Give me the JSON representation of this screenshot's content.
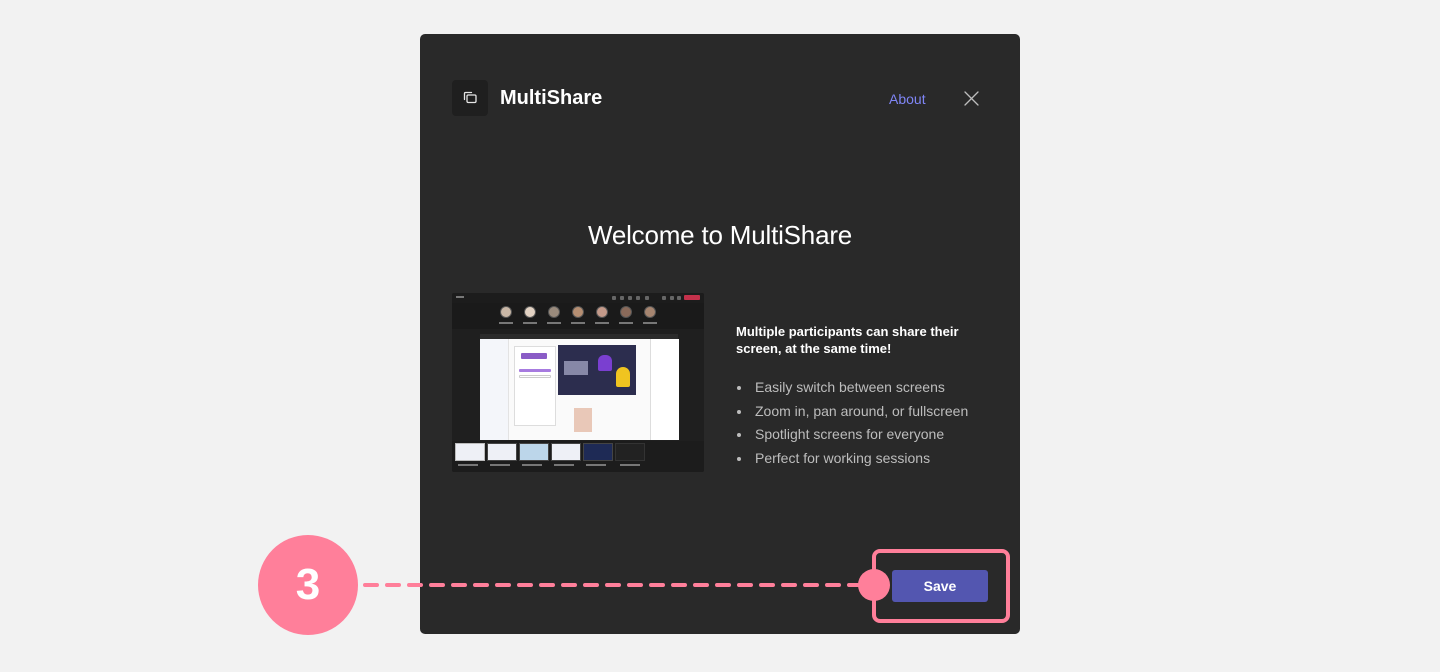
{
  "dialog": {
    "app_name": "MultiShare",
    "app_icon": "multishare-icon",
    "about_label": "About",
    "close_icon": "close-icon",
    "welcome_title": "Welcome to MultiShare",
    "preview_image": "multishare-meeting-preview",
    "feature_heading": "Multiple participants can share their screen, at the same time!",
    "features": [
      "Easily switch between screens",
      "Zoom in, pan around, or fullscreen",
      "Spotlight screens for everyone",
      "Perfect for working sessions"
    ],
    "save_label": "Save"
  },
  "annotation": {
    "step_number": "3",
    "color": "#ff7f9a"
  },
  "colors": {
    "dialog_bg": "#292929",
    "page_bg": "#f2f2f2",
    "accent": "#5356b0",
    "link": "#7f85f5"
  }
}
